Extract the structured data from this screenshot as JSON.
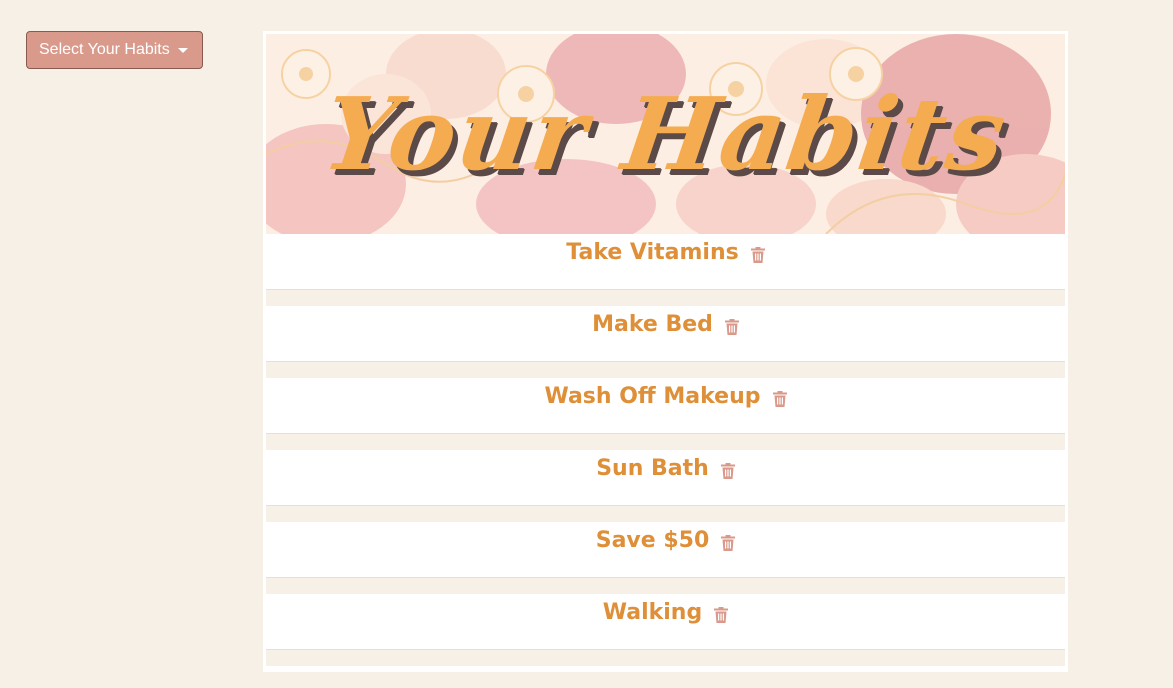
{
  "dropdown": {
    "label": "Select Your Habits"
  },
  "banner": {
    "title": "Your Habits"
  },
  "habits": [
    {
      "name": "Take Vitamins"
    },
    {
      "name": "Make Bed"
    },
    {
      "name": "Wash Off Makeup"
    },
    {
      "name": "Sun Bath"
    },
    {
      "name": "Save $50"
    },
    {
      "name": "Walking"
    }
  ],
  "colors": {
    "background": "#f6f0e7",
    "button": "#d99a8b",
    "habit_text": "#de8f37",
    "trash_icon": "#d99a8b",
    "banner_title": "#f5ac50"
  }
}
